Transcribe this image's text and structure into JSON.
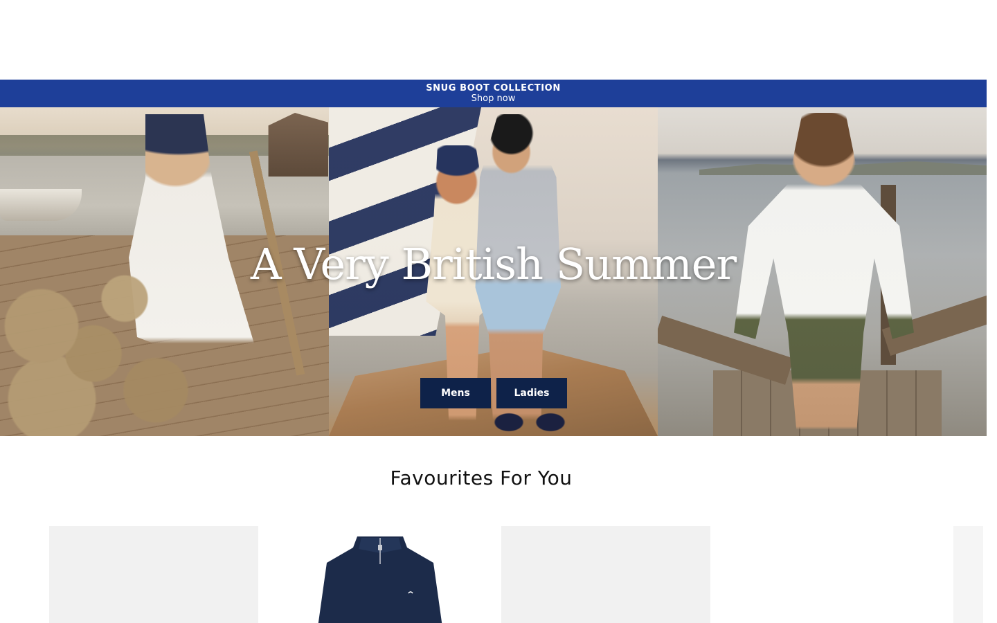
{
  "promo": {
    "title": "SNUG BOOT COLLECTION",
    "link": "Shop now",
    "background": "#1e3f99"
  },
  "hero": {
    "title": "A Very British Summer",
    "buttons": [
      "Mens",
      "Ladies"
    ],
    "button_color": "#0e2249"
  },
  "favourites": {
    "title": "Favourites For You"
  }
}
